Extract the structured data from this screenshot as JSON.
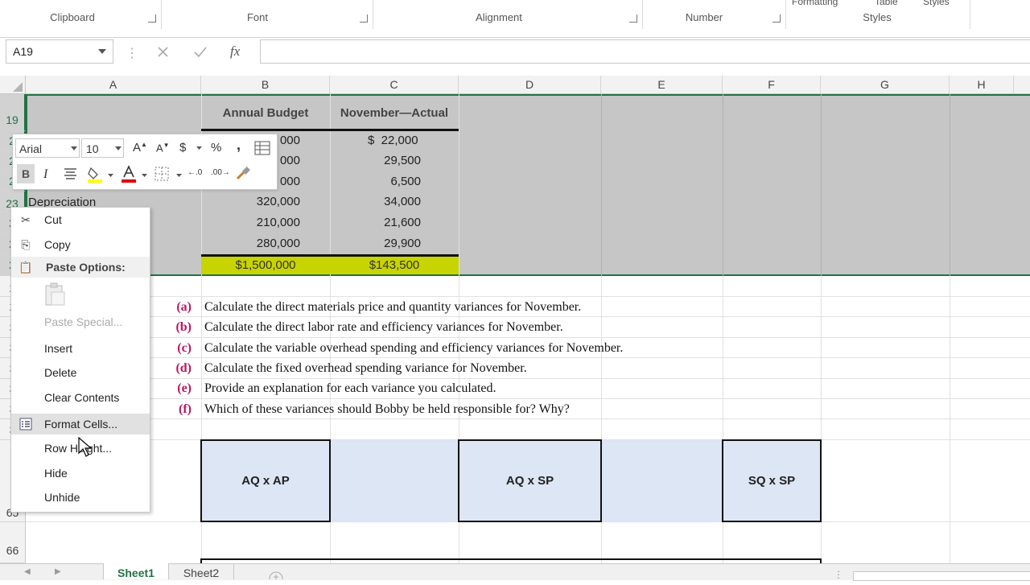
{
  "ribbon": {
    "groups": [
      "Clipboard",
      "Font",
      "Alignment",
      "Number",
      "Styles"
    ],
    "top_partial": [
      "Formatting",
      "Table",
      "Styles"
    ]
  },
  "formula_bar": {
    "name_box": "A19",
    "cancel_icon": "x-icon",
    "enter_icon": "check-icon",
    "fx_label": "fx",
    "formula": ""
  },
  "columns": [
    "A",
    "B",
    "C",
    "D",
    "E",
    "F",
    "G",
    "H"
  ],
  "row_numbers": {
    "r19": "19",
    "r23": "23",
    "r65": "65",
    "r66": "66",
    "partial": [
      "2",
      "2",
      "2",
      "2",
      "2",
      "2",
      "2",
      "2",
      "3",
      "3",
      "3",
      "3",
      "3",
      "3"
    ]
  },
  "table": {
    "header_b": "Annual Budget",
    "header_c": "November—Actual",
    "depreciation_label": "Depreciation",
    "b_values": [
      "000",
      "000",
      "000",
      "320,000",
      "210,000",
      "280,000"
    ],
    "c_values": [
      "$  22,000",
      "29,500",
      "6,500",
      "34,000",
      "21,600",
      "29,900"
    ],
    "total_b": "$1,500,000",
    "total_c": "$143,500"
  },
  "questions": [
    {
      "label": "(a)",
      "text": "Calculate the direct materials price and quantity variances for November."
    },
    {
      "label": "(b)",
      "text": "Calculate the direct labor rate and efficiency variances for November."
    },
    {
      "label": "(c)",
      "text": "Calculate the variable overhead spending and efficiency variances for November."
    },
    {
      "label": "(d)",
      "text": "Calculate the fixed overhead spending variance for November."
    },
    {
      "label": "(e)",
      "text": "Provide an explanation for each variance you calculated."
    },
    {
      "label": "(f)",
      "text": "Which of these variances should Bobby be held responsible for? Why?"
    }
  ],
  "boxes": [
    "AQ x AP",
    "AQ x SP",
    "SQ x SP"
  ],
  "mini_toolbar": {
    "font": "Arial",
    "size": "10",
    "bold": "B",
    "italic": "I",
    "currency": "$",
    "percent": "%",
    "comma": ","
  },
  "context_menu": {
    "cut": "Cut",
    "copy": "Copy",
    "paste_options": "Paste Options:",
    "paste_special": "Paste Special...",
    "insert": "Insert",
    "delete": "Delete",
    "clear_contents": "Clear Contents",
    "format_cells": "Format Cells...",
    "row_height": "Row Height...",
    "hide": "Hide",
    "unhide": "Unhide"
  },
  "sheet_tabs": [
    "Sheet1",
    "Sheet2"
  ],
  "colors": {
    "selection": "#c6c6c6",
    "total_fill": "#c8d400",
    "question_label": "#c0135d",
    "box_fill": "#dce6f5",
    "selected_row_header": "#217346"
  }
}
